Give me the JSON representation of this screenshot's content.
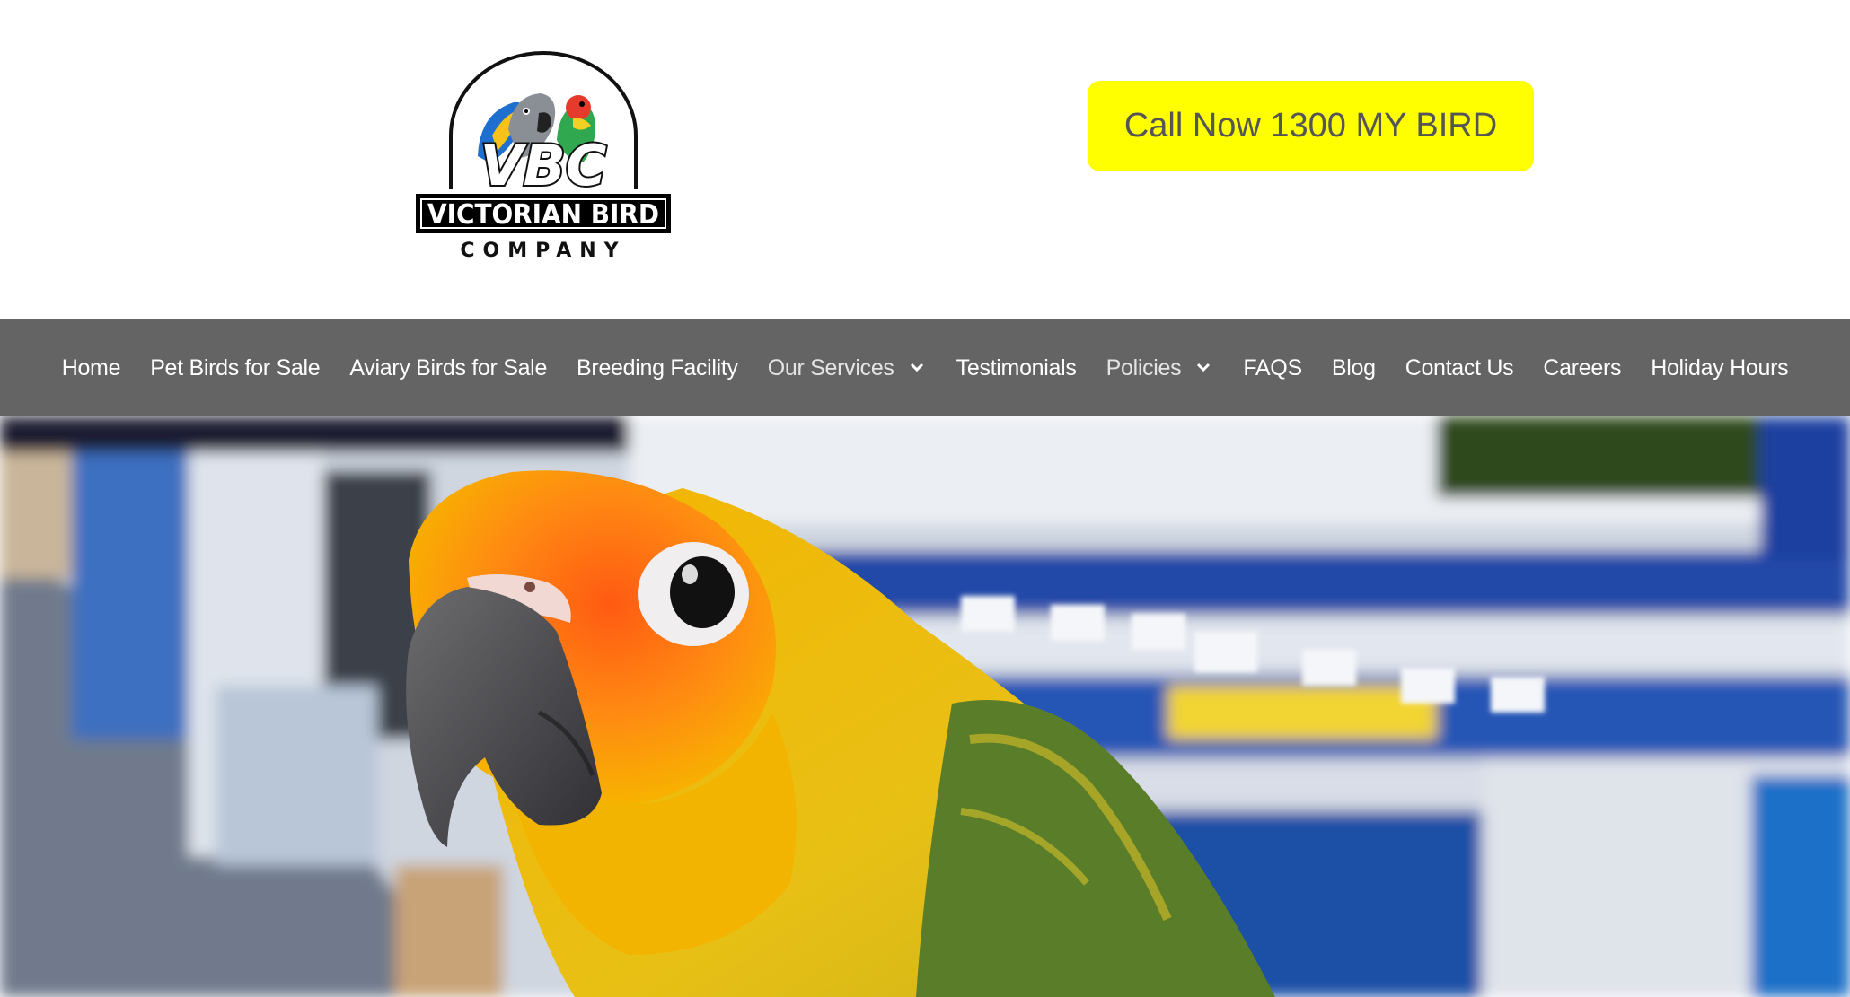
{
  "brand": {
    "logo_initials": "VBC",
    "logo_name": "VICTORIAN BIRD",
    "logo_sub": "COMPANY"
  },
  "cta": {
    "label": "Call Now 1300 MY BIRD"
  },
  "colors": {
    "cta_bg": "#ffff00",
    "nav_bg": "#646464",
    "text_muted": "#555555"
  },
  "nav": {
    "items": [
      {
        "label": "Home",
        "icon": ""
      },
      {
        "label": "Pet Birds for Sale",
        "icon": ""
      },
      {
        "label": "Aviary Birds for Sale",
        "icon": ""
      },
      {
        "label": "Breeding Facility",
        "icon": ""
      },
      {
        "label": "Our Services",
        "icon": "chevron-down-icon"
      },
      {
        "label": "Testimonials",
        "icon": ""
      },
      {
        "label": "Policies",
        "icon": "chevron-down-icon"
      },
      {
        "label": "FAQS",
        "icon": ""
      },
      {
        "label": "Blog",
        "icon": ""
      },
      {
        "label": "Contact Us",
        "icon": ""
      },
      {
        "label": "Careers",
        "icon": ""
      },
      {
        "label": "Holiday Hours",
        "icon": ""
      }
    ]
  },
  "hero": {
    "subject": "sun-conure-parrot-in-pet-store"
  }
}
